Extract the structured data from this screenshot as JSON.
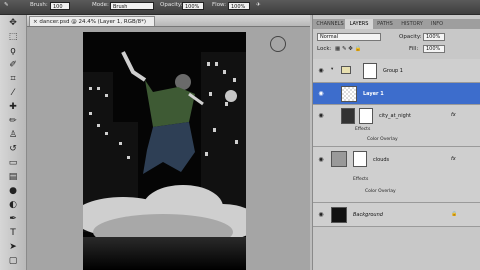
{
  "options_bar": {
    "brush_label": "Brush:",
    "brush_size": "100",
    "mode_label": "Mode:",
    "mode_value": "Brush",
    "opacity_label": "Opacity:",
    "opacity_value": "100%",
    "flow_label": "Flow:",
    "flow_value": "100%"
  },
  "document": {
    "tab_title": "dancer.psd @ 24.4% (Layer 1, RGB/8*)"
  },
  "layers_panel": {
    "tabs": [
      "CHANNELS",
      "LAYERS",
      "PATHS",
      "HISTORY",
      "INFO"
    ],
    "active_tab": "LAYERS",
    "blend_mode": "Normal",
    "opacity_label": "Opacity:",
    "opacity_value": "100%",
    "lock_label": "Lock:",
    "fill_label": "Fill:",
    "fill_value": "100%",
    "layers": [
      {
        "name": "Group 1"
      },
      {
        "name": "Layer 1"
      },
      {
        "name": "city_at_night",
        "effects_label": "Effects",
        "effect": "Color Overlay"
      },
      {
        "name": "clouds",
        "effects_label": "Effects",
        "effect": "Color Overlay"
      },
      {
        "name": "Background"
      }
    ],
    "fx_symbol": "fx",
    "lock_symbol": "🔒"
  },
  "colors": {
    "selected_layer": "#3d6dcc",
    "canvas_bg": "#050505"
  }
}
